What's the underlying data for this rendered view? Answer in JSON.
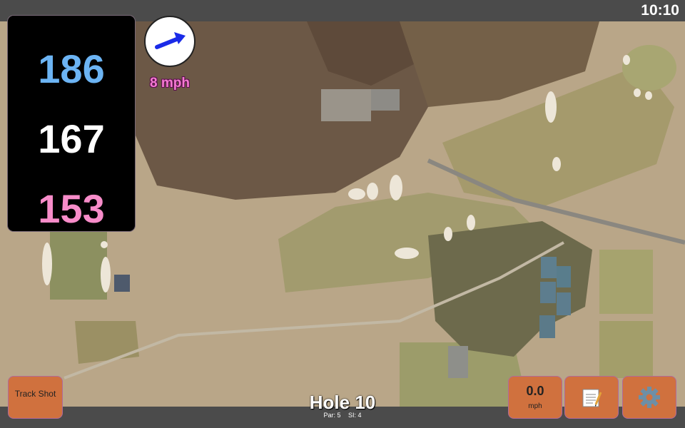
{
  "status": {
    "clock": "10:10"
  },
  "distances": {
    "back": "186",
    "center": "167",
    "front": "153"
  },
  "wind": {
    "speed_label": "8 mph",
    "direction_icon": "wind-arrow-icon"
  },
  "buttons": {
    "track_shot": "Track Shot",
    "wind_value": "0.0",
    "wind_unit": "mph",
    "notes_icon": "notepad-icon",
    "settings_icon": "gear-icon"
  },
  "hole": {
    "title": "Hole 10",
    "par": "Par: 5",
    "si": "SI: 4"
  },
  "colors": {
    "back": "#6cb4f4",
    "center": "#ffffff",
    "front": "#f78cc9",
    "button": "#d0713e",
    "wind_text": "#f57ad2"
  }
}
